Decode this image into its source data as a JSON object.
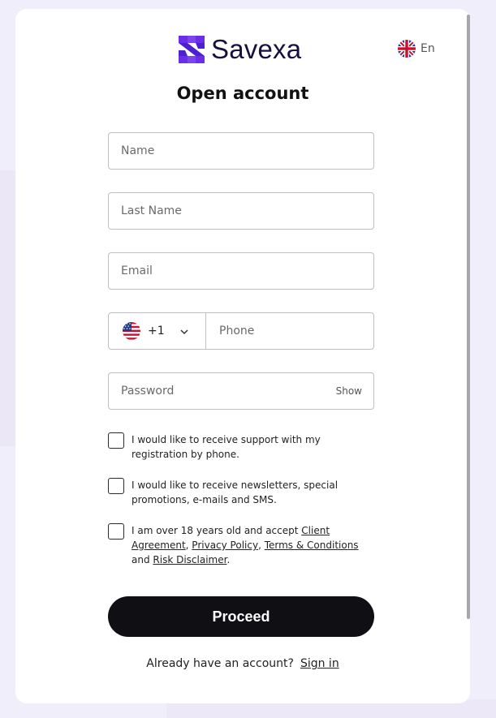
{
  "brand": {
    "name": "Savexa",
    "color": "#5b2be0"
  },
  "language": {
    "label": "En",
    "icon": "uk-flag-icon"
  },
  "title": "Open account",
  "fields": {
    "name_placeholder": "Name",
    "lastname_placeholder": "Last Name",
    "email_placeholder": "Email",
    "phone": {
      "country_code": "+1",
      "country_icon": "us-flag-icon",
      "placeholder": "Phone"
    },
    "password_placeholder": "Password",
    "password_show_label": "Show"
  },
  "checkboxes": {
    "support": "I would like to receive support with my registration by phone.",
    "newsletter": "I would like to receive newsletters, special promotions, e-mails and SMS.",
    "terms": {
      "prefix": "I am over 18 years old and accept ",
      "client_agreement": "Client Agreement",
      "sep1": ", ",
      "privacy_policy": "Privacy Policy",
      "sep2": ", ",
      "terms_conditions": "Terms & Conditions",
      "and": " and ",
      "risk_disclaimer": "Risk Disclaimer",
      "suffix": "."
    }
  },
  "proceed_label": "Proceed",
  "signin": {
    "prompt": "Already have an account?",
    "link": "Sign in"
  }
}
